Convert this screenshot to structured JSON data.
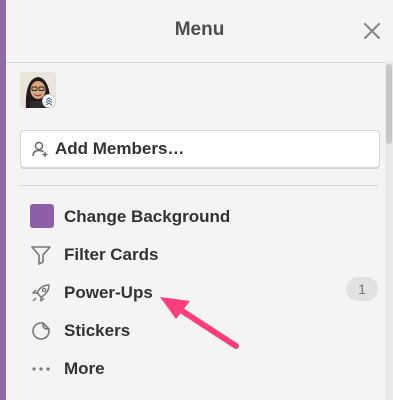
{
  "header": {
    "title": "Menu"
  },
  "members": {
    "add_label": "Add Members…"
  },
  "colors": {
    "background_swatch": "#8e5ea7",
    "arrow": "#ff3c7e",
    "board_bg": "#8e6aa6"
  },
  "menu": {
    "items": [
      {
        "label": "Change Background",
        "icon": "background-swatch"
      },
      {
        "label": "Filter Cards",
        "icon": "filter-icon"
      },
      {
        "label": "Power-Ups",
        "icon": "rocket-icon",
        "badge": "1"
      },
      {
        "label": "Stickers",
        "icon": "sticker-icon"
      },
      {
        "label": "More",
        "icon": "more-icon"
      }
    ]
  }
}
